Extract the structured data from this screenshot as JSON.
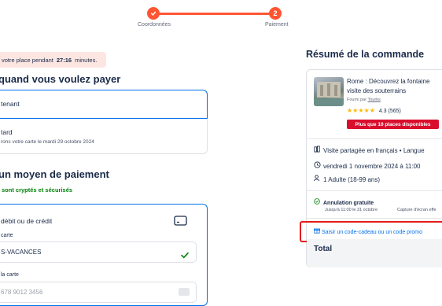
{
  "stepper": {
    "step1_label": "Coordonnées",
    "step2_label": "Paiement",
    "step2_number": "2"
  },
  "timer": {
    "prefix": "votre place pendant",
    "time": "27:16",
    "suffix": "minutes."
  },
  "pay_when": {
    "heading": "quand vous voulez payer",
    "option_now": "tenant",
    "option_later": "tard",
    "option_later_note": "rons votre carte le mardi 29 octobre 2024"
  },
  "payment_method": {
    "heading": "un moyen de paiement",
    "secure_text": "sont cryptés et sécurisés",
    "card_option_label": "débit ou de crédit",
    "holder_label": "carte",
    "holder_value": "S-VACANCES",
    "number_label": "la carte",
    "number_placeholder": "678 9012 3456"
  },
  "summary": {
    "title": "Résumé de la commande",
    "activity_title_line1": "Rome : Découvrez la fontaine",
    "activity_title_line2": "visite des souterrains",
    "provider_prefix": "Fourni par",
    "provider_name": "Tourks",
    "rating": "4.3 (565)",
    "stars": 4.5,
    "availability_badge": "Plus que 10 places disponibles",
    "tour_type": "Visite partagée en français • Langue",
    "date": "vendredi 1 novembre 2024 à 11:00",
    "participants": "1 Adulte (18-99 ans)",
    "cancellation_title": "Annulation gratuite",
    "cancellation_note": "Jusqu'à 11:00 le 31 octobre",
    "screenshot_note": "Capture d'écran effe",
    "promo_link": "Saisir un code-cadeau ou un code promo",
    "total_label": "Total"
  },
  "colors": {
    "accent": "#ff5533",
    "link": "#0071eb",
    "success": "#008009",
    "badge": "#d90d2c",
    "star": "#ffb800"
  }
}
